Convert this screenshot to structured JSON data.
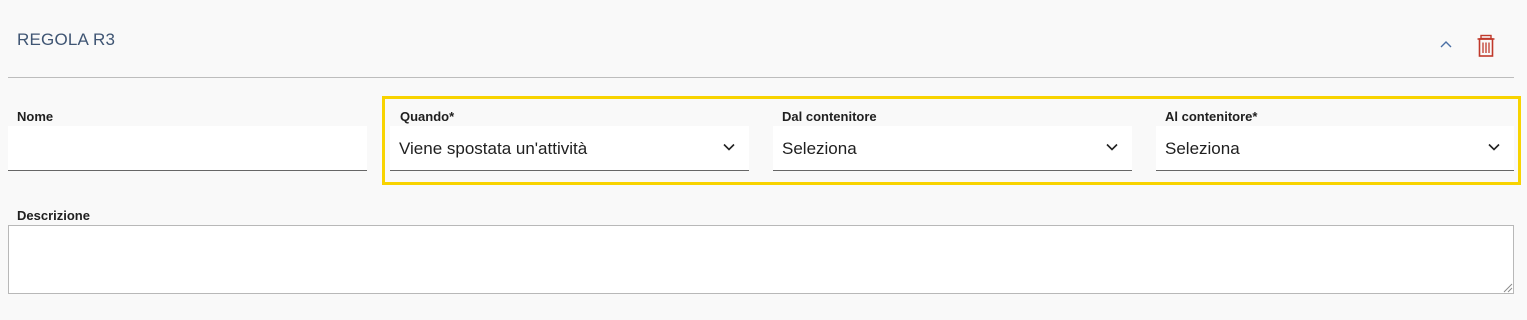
{
  "rule": {
    "title": "REGOLA R3"
  },
  "fields": {
    "nome": {
      "label": "Nome",
      "value": ""
    },
    "quando": {
      "label": "Quando*",
      "value": "Viene spostata un'attività"
    },
    "dal_contenitore": {
      "label": "Dal contenitore",
      "value": "Seleziona"
    },
    "al_contenitore": {
      "label": "Al contenitore*",
      "value": "Seleziona"
    },
    "descrizione": {
      "label": "Descrizione",
      "value": ""
    }
  },
  "icons": {
    "collapse": "chevron-up-icon",
    "delete": "trash-icon",
    "dropdown": "chevron-down-icon"
  },
  "colors": {
    "title": "#3f5573",
    "delete_icon": "#c0392b",
    "collapse_icon": "#4a6fa5",
    "highlight": "#f8d300"
  }
}
